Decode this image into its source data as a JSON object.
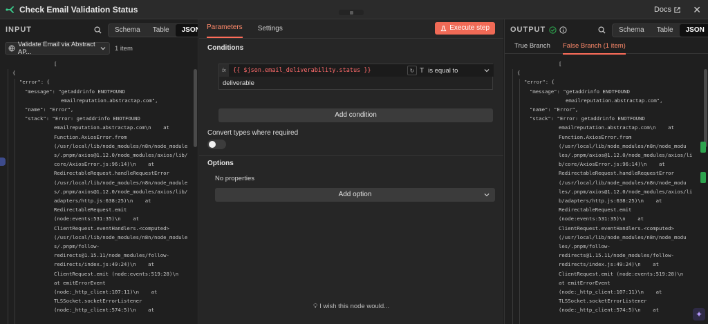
{
  "window": {
    "title": "Check Email Validation Status",
    "docs_label": "Docs",
    "close_glyph": "✕"
  },
  "input": {
    "title": "INPUT",
    "view_modes": [
      "Schema",
      "Table",
      "JSON"
    ],
    "active_view": "JSON",
    "source_node": "Validate Email via Abstract AP...",
    "item_count": "1 item",
    "json_lines": [
      "[",
      "{",
      "\"error\": {",
      "\"message\": \"getaddrinfo ENOTFOUND",
      "emailreputation.abstractap.com\",",
      "\"name\": \"Error\",",
      "\"stack\": \"Error: getaddrinfo ENOTFOUND",
      "emailreputation.abstractap.com\\n    at",
      "Function.AxiosError.from",
      "(/usr/local/lib/node_modules/n8n/node_module",
      "s/.pnpm/axios@1.12.0/node_modules/axios/lib/",
      "core/AxiosError.js:96:14)\\n    at",
      "RedirectableRequest.handleRequestError",
      "(/usr/local/lib/node_modules/n8n/node_module",
      "s/.pnpm/axios@1.12.0/node_modules/axios/lib/",
      "adapters/http.js:638:25)\\n    at",
      "RedirectableRequest.emit",
      "(node:events:531:35)\\n    at",
      "ClientRequest.eventHandlers.<computed>",
      "(/usr/local/lib/node_modules/n8n/node_module",
      "s/.pnpm/follow-",
      "redirects@1.15.11/node_modules/follow-",
      "redirects/index.js:49:24)\\n    at",
      "ClientRequest.emit (node:events:519:28)\\n",
      "at emitErrorEvent",
      "(node:_http_client:107:11)\\n    at",
      "TLSSocket.socketErrorListener",
      "(node:_http_client:574:5)\\n    at"
    ]
  },
  "params": {
    "tabs": [
      "Parameters",
      "Settings"
    ],
    "active_tab": "Parameters",
    "execute_label": "Execute step",
    "conditions_label": "Conditions",
    "fx_label": "fx",
    "expression": "{{ $json.email_deliverability.status }}",
    "operator_type_glyph": "T",
    "operator": "is equal to",
    "value": "deliverable",
    "add_condition_label": "Add condition",
    "convert_types_label": "Convert types where required",
    "convert_types_enabled": false,
    "options_label": "Options",
    "no_properties_label": "No properties",
    "add_option_label": "Add option",
    "wish_label": "I wish this node would..."
  },
  "output": {
    "title": "OUTPUT",
    "view_modes": [
      "Schema",
      "Table",
      "JSON"
    ],
    "active_view": "JSON",
    "branch_tabs": [
      "True Branch",
      "False Branch (1 item)"
    ],
    "active_branch": "False Branch (1 item)",
    "json_lines": [
      "[",
      "{",
      "\"error\": {",
      "\"message\": \"getaddrinfo ENOTFOUND",
      "emailreputation.abstractap.com\",",
      "\"name\": \"Error\",",
      "\"stack\": \"Error: getaddrinfo ENOTFOUND",
      "emailreputation.abstractap.com\\n    at",
      "Function.AxiosError.from",
      "(/usr/local/lib/node_modules/n8n/node_modu",
      "les/.pnpm/axios@1.12.0/node_modules/axios/li",
      "b/core/AxiosError.js:96:14)\\n    at",
      "RedirectableRequest.handleRequestError",
      "(/usr/local/lib/node_modules/n8n/node_modu",
      "les/.pnpm/axios@1.12.0/node_modules/axios/li",
      "b/adapters/http.js:638:25)\\n    at",
      "RedirectableRequest.emit",
      "(node:events:531:35)\\n    at",
      "ClientRequest.eventHandlers.<computed>",
      "(/usr/local/lib/node_modules/n8n/node_modu",
      "les/.pnpm/follow-",
      "redirects@1.15.11/node_modules/follow-",
      "redirects/index.js:49:24)\\n    at",
      "ClientRequest.emit (node:events:519:28)\\n",
      "at emitErrorEvent",
      "(node:_http_client:107:11)\\n    at",
      "TLSSocket.socketErrorListener",
      "(node:_http_client:574:5)\\n    at"
    ]
  },
  "colors": {
    "accent": "#ff6d5a",
    "execute_button": "#f06a56",
    "expression_text": "#ff6b6b",
    "success_green": "#2ea44f"
  },
  "icons": {
    "title": "if-node-icon",
    "docs": "external-link-icon",
    "search": "search-icon",
    "execute": "flask-icon",
    "output_status": "check-circle-icon",
    "output_info": "info-icon",
    "source_node": "globe-icon",
    "chevron": "chevron-down-icon",
    "wish": "lightbulb-icon"
  }
}
